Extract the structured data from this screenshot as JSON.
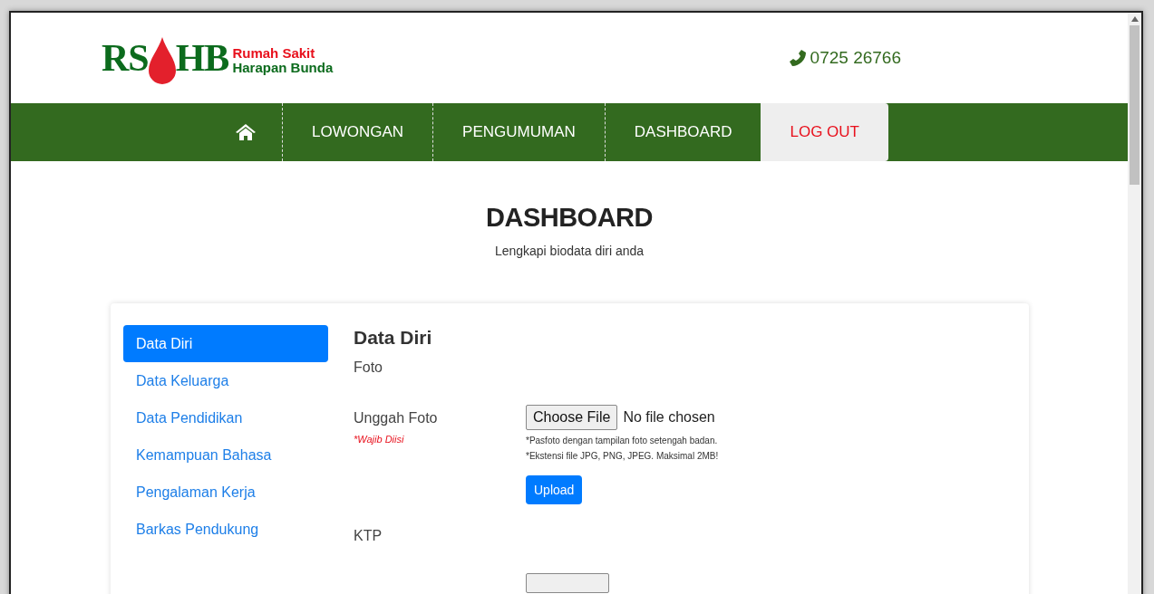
{
  "header": {
    "logo": {
      "letters_left": "RS",
      "letters_right": "HB",
      "line_1": "Rumah Sakit",
      "line_2": "Harapan Bunda"
    },
    "phone": "0725 26766"
  },
  "nav": [
    {
      "kind": "home"
    },
    {
      "kind": "link",
      "label": "LOWONGAN"
    },
    {
      "kind": "link",
      "label": "PENGUMUMAN"
    },
    {
      "kind": "link",
      "label": "DASHBOARD"
    },
    {
      "kind": "logout",
      "label": "LOG OUT"
    }
  ],
  "page": {
    "title": "DASHBOARD",
    "subtitle": "Lengkapi biodata diri anda"
  },
  "sidebar": [
    {
      "label": "Data Diri",
      "selected": true
    },
    {
      "label": "Data Keluarga",
      "selected": false
    },
    {
      "label": "Data Pendidikan",
      "selected": false
    },
    {
      "label": "Kemampuan Bahasa",
      "selected": false
    },
    {
      "label": "Pengalaman Kerja",
      "selected": false
    },
    {
      "label": "Barkas Pendukung",
      "selected": false
    }
  ],
  "form": {
    "heading": "Data Diri",
    "sections": [
      {
        "title": "Foto",
        "field": {
          "label": "Unggah Foto",
          "required_note": "*Wajib Diisi",
          "file_button": "Choose File",
          "file_status": "No file chosen",
          "hints": [
            "*Pasfoto dengan tampilan foto setengah badan.",
            "*Ekstensi file JPG, PNG, JPEG. Maksimal 2MB!"
          ],
          "upload_button": "Upload"
        }
      },
      {
        "title": "KTP"
      }
    ]
  }
}
